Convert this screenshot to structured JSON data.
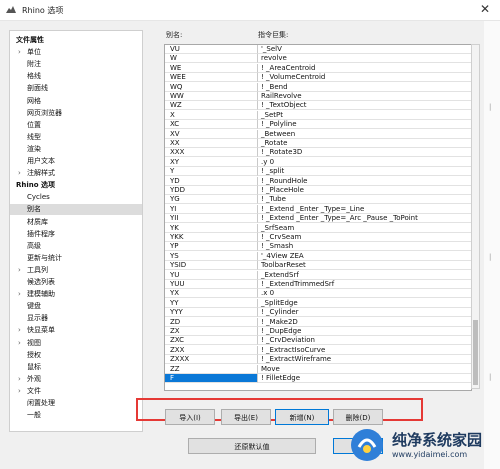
{
  "window": {
    "title": "Rhino 选项",
    "close_glyph": "✕"
  },
  "nav": {
    "items": [
      {
        "label": "文件属性",
        "root": true
      },
      {
        "label": "单位",
        "arrow": true
      },
      {
        "label": "附注"
      },
      {
        "label": "格线"
      },
      {
        "label": "剖面线"
      },
      {
        "label": "网格"
      },
      {
        "label": "网页浏览器"
      },
      {
        "label": "位置"
      },
      {
        "label": "线型"
      },
      {
        "label": "渲染"
      },
      {
        "label": "用户文本"
      },
      {
        "label": "注解样式",
        "arrow": true
      },
      {
        "label": "Rhino 选项",
        "root": true
      },
      {
        "label": "Cycles"
      },
      {
        "label": "别名",
        "selected": true
      },
      {
        "label": "材质库"
      },
      {
        "label": "插件程序"
      },
      {
        "label": "高级"
      },
      {
        "label": "更新与统计"
      },
      {
        "label": "工具列",
        "arrow": true
      },
      {
        "label": "候选列表"
      },
      {
        "label": "建模辅助",
        "arrow": true
      },
      {
        "label": "键盘"
      },
      {
        "label": "显示器"
      },
      {
        "label": "快显菜单",
        "arrow": true
      },
      {
        "label": "视图",
        "arrow": true
      },
      {
        "label": "授权"
      },
      {
        "label": "鼠标"
      },
      {
        "label": "外观",
        "arrow": true
      },
      {
        "label": "文件",
        "arrow": true
      },
      {
        "label": "闲置处理"
      },
      {
        "label": "一般"
      }
    ]
  },
  "table": {
    "col_alias": "别名:",
    "col_macro": "指令巨集:",
    "rows": [
      {
        "alias": "VU",
        "macro": "'_SelV"
      },
      {
        "alias": "W",
        "macro": "revolve"
      },
      {
        "alias": "WE",
        "macro": "! _AreaCentroid"
      },
      {
        "alias": "WEE",
        "macro": "! _VolumeCentroid"
      },
      {
        "alias": "WQ",
        "macro": "! _Bend"
      },
      {
        "alias": "WW",
        "macro": "RailRevolve"
      },
      {
        "alias": "WZ",
        "macro": "! _TextObject"
      },
      {
        "alias": "X",
        "macro": "_SetPt"
      },
      {
        "alias": "XC",
        "macro": "! _Polyline"
      },
      {
        "alias": "XV",
        "macro": "_Between"
      },
      {
        "alias": "XX",
        "macro": "_Rotate"
      },
      {
        "alias": "XXX",
        "macro": "! _Rotate3D"
      },
      {
        "alias": "XY",
        "macro": ".y 0"
      },
      {
        "alias": "Y",
        "macro": "! _split"
      },
      {
        "alias": "YD",
        "macro": "! _RoundHole"
      },
      {
        "alias": "YDD",
        "macro": "! _PlaceHole"
      },
      {
        "alias": "YG",
        "macro": "! _Tube"
      },
      {
        "alias": "YI",
        "macro": "! _Extend _Enter _Type=_Line"
      },
      {
        "alias": "YII",
        "macro": "! _Extend _Enter _Type=_Arc _Pause _ToPoint"
      },
      {
        "alias": "YK",
        "macro": "_SrfSeam"
      },
      {
        "alias": "YKK",
        "macro": "! _CrvSeam"
      },
      {
        "alias": "YP",
        "macro": "! _Smash"
      },
      {
        "alias": "YS",
        "macro": "'_4View ZEA"
      },
      {
        "alias": "YSID",
        "macro": "ToolbarReset"
      },
      {
        "alias": "YU",
        "macro": "_ExtendSrf"
      },
      {
        "alias": "YUU",
        "macro": "! _ExtendTrimmedSrf"
      },
      {
        "alias": "YX",
        "macro": ".x 0"
      },
      {
        "alias": "YY",
        "macro": "_SplitEdge"
      },
      {
        "alias": "YYY",
        "macro": "! _Cylinder"
      },
      {
        "alias": "ZD",
        "macro": "! _Make2D"
      },
      {
        "alias": "ZX",
        "macro": "! _DupEdge"
      },
      {
        "alias": "ZXC",
        "macro": "! _CrvDeviation"
      },
      {
        "alias": "ZXX",
        "macro": "! _ExtractIsoCurve"
      },
      {
        "alias": "ZXXX",
        "macro": "! _ExtractWireframe"
      },
      {
        "alias": "ZZ",
        "macro": "Move"
      },
      {
        "alias": "F",
        "macro": "! FilletEdge",
        "selected": true
      }
    ]
  },
  "buttons": {
    "import": "导入(I)",
    "export": "导出(E)",
    "new": "新增(N)",
    "delete": "删除(D)",
    "restore": "还原默认值",
    "ok": "确"
  },
  "watermark": {
    "name": "纯净系统家园",
    "url": "www.yidaimei.com"
  },
  "colors": {
    "selection": "#0a78d7",
    "highlight_box": "#e53935",
    "dialog_bg": "#f0f0f0"
  }
}
